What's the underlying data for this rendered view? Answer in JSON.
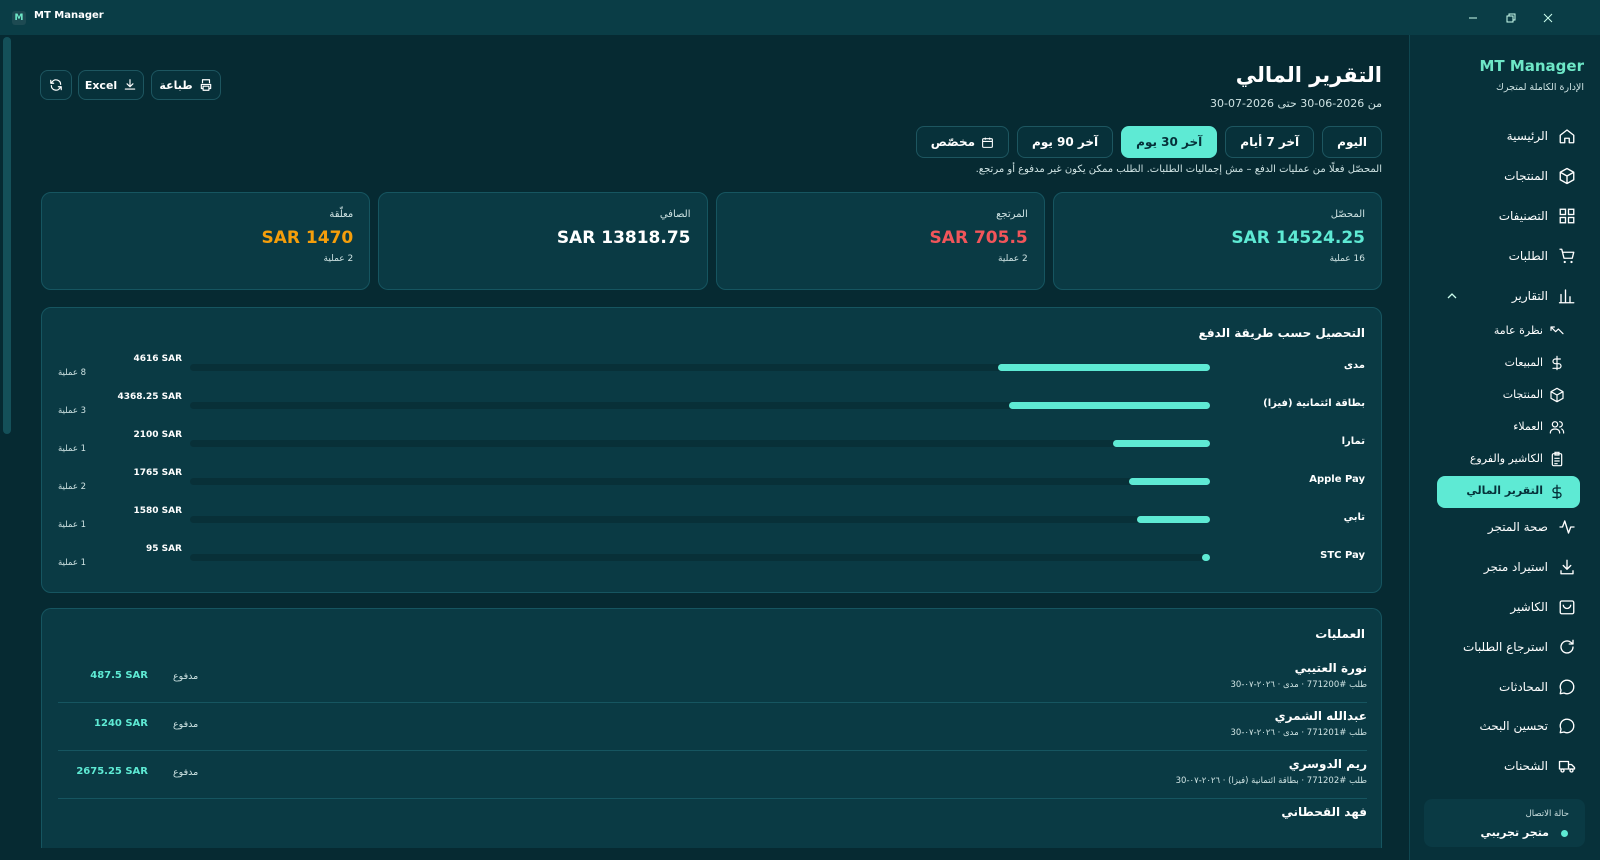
{
  "window": {
    "title": "MT Manager",
    "logo_letter": "M"
  },
  "header": {
    "title": "التقرير المالي",
    "range": "من 2026-06-30 حتى 2026-07-30",
    "print_label": "طباعة",
    "excel_label": "Excel"
  },
  "periods": [
    {
      "label": "اليوم",
      "active": false
    },
    {
      "label": "آخر 7 أيام",
      "active": false
    },
    {
      "label": "آخر 30 يوم",
      "active": true
    },
    {
      "label": "آخر 90 يوم",
      "active": false
    },
    {
      "label": "مخصّص",
      "active": false
    }
  ],
  "note": "المحصّل فعلًا من عمليات الدفع – مش إجماليات الطلبات. الطلب ممكن يكون غير مدفوع أو مرتجع.",
  "stats": [
    {
      "label": "المحصّل",
      "value": "14524.25 SAR",
      "sub": "16 عملية",
      "color": "#5eead4"
    },
    {
      "label": "المرتجع",
      "value": "705.5 SAR",
      "sub": "2 عملية",
      "color": "#f2555a"
    },
    {
      "label": "الصافي",
      "value": "13818.75 SAR",
      "sub": "",
      "color": "#ffffff"
    },
    {
      "label": "معلّقة",
      "value": "1470 SAR",
      "sub": "2 عملية",
      "color": "#f59e0b"
    }
  ],
  "payments": {
    "title": "التحصيل حسب طريقة الدفع",
    "max": 4616,
    "rows": [
      {
        "name": "مدى",
        "amount": "4616 SAR",
        "value": 4616,
        "count": "8 عملية"
      },
      {
        "name": "بطاقة ائتمانية (فيزا)",
        "amount": "4368.25 SAR",
        "value": 4368.25,
        "count": "3 عملية"
      },
      {
        "name": "تمارا",
        "amount": "2100 SAR",
        "value": 2100,
        "count": "1 عملية"
      },
      {
        "name": "Apple Pay",
        "amount": "1765 SAR",
        "value": 1765,
        "count": "2 عملية"
      },
      {
        "name": "تابي",
        "amount": "1580 SAR",
        "value": 1580,
        "count": "1 عملية"
      },
      {
        "name": "STC Pay",
        "amount": "95 SAR",
        "value": 95,
        "count": "1 عملية"
      }
    ]
  },
  "transactions": {
    "title": "العمليات",
    "rows": [
      {
        "name": "نورة العتيبي",
        "meta": "طلب #771200 · مدى · ٢٠٢٦-٠٧-30",
        "status": "مدفوع",
        "amount": "487.5 SAR"
      },
      {
        "name": "عبدالله الشمري",
        "meta": "طلب #771201 · مدى · ٢٠٢٦-٠٧-30",
        "status": "مدفوع",
        "amount": "1240 SAR"
      },
      {
        "name": "ريم الدوسري",
        "meta": "طلب #771202 · بطاقة ائتمانية (فيزا) · ٢٠٢٦-٠٧-30",
        "status": "مدفوع",
        "amount": "2675.25 SAR"
      },
      {
        "name": "فهد القحطاني",
        "meta": "",
        "status": "",
        "amount": ""
      }
    ]
  },
  "sidebar": {
    "brand": "MT Manager",
    "subtitle": "الإدارة الكاملة لمتجرك",
    "items": [
      {
        "label": "الرئيسية",
        "icon": "home-icon"
      },
      {
        "label": "المنتجات",
        "icon": "box-icon"
      },
      {
        "label": "التصنيفات",
        "icon": "grid-icon"
      },
      {
        "label": "الطلبات",
        "icon": "cart-icon"
      },
      {
        "label": "التقارير",
        "icon": "bar-chart-icon"
      }
    ],
    "report_subitems": [
      {
        "label": "نظرة عامة",
        "icon": "trend-icon"
      },
      {
        "label": "المبيعات",
        "icon": "dollar-icon"
      },
      {
        "label": "المنتجات",
        "icon": "box-icon"
      },
      {
        "label": "العملاء",
        "icon": "users-icon"
      },
      {
        "label": "الكاشير والفروع",
        "icon": "clipboard-icon"
      },
      {
        "label": "التقرير المالي",
        "icon": "dollar-icon"
      }
    ],
    "items_after": [
      {
        "label": "صحة المتجر",
        "icon": "pulse-icon"
      },
      {
        "label": "استيراد متجر",
        "icon": "download-icon"
      },
      {
        "label": "الكاشير",
        "icon": "register-icon"
      },
      {
        "label": "استرجاع الطلبات",
        "icon": "refresh-icon"
      },
      {
        "label": "المحادثات",
        "icon": "chat-icon"
      },
      {
        "label": "تحسين البحث",
        "icon": "chat-icon"
      },
      {
        "label": "الشحنات",
        "icon": "truck-icon"
      }
    ],
    "connection_label": "حالة الاتصال",
    "connection_value": "متجر تجريبي"
  },
  "colors": {
    "accent": "#5eead4",
    "bg": "#062a32",
    "card": "#0a3a44",
    "danger": "#f2555a",
    "warning": "#f59e0b"
  }
}
